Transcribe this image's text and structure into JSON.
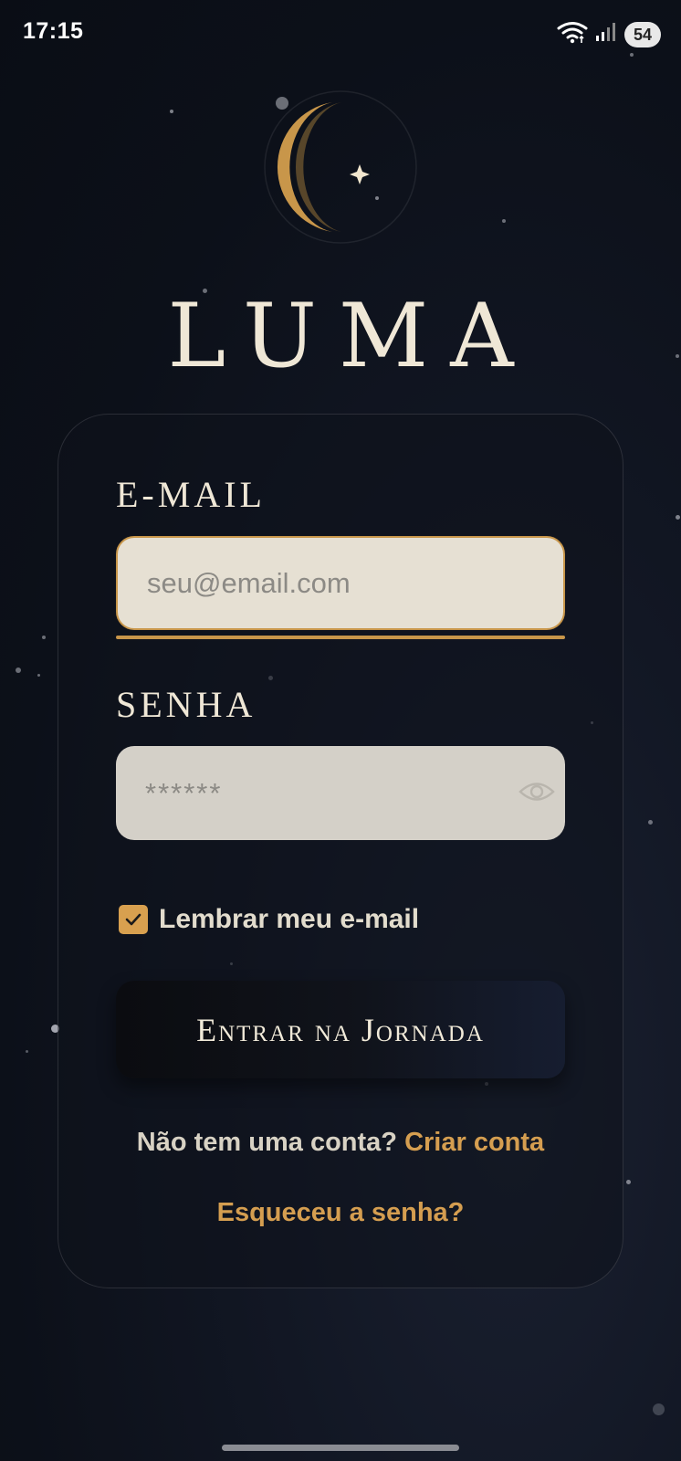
{
  "status_bar": {
    "time": "17:15",
    "battery": "54",
    "icons": [
      "wifi-icon",
      "signal-icon",
      "battery-icon"
    ]
  },
  "brand": {
    "name": "LUMA",
    "logo_icon": "crescent-moon-star-icon",
    "colors": {
      "gold": "#c8964a",
      "cream": "#efe7d6",
      "background": "#0e121c"
    }
  },
  "login_form": {
    "email_label": "E-MAIL",
    "email_placeholder": "seu@email.com",
    "password_label": "SENHA",
    "password_placeholder": "******",
    "show_password_icon": "eye-icon",
    "remember_label": "Lembrar meu e-mail",
    "remember_checked": true,
    "submit_label": "Entrar na Jornada",
    "no_account_text": "Não tem uma conta?",
    "create_account_link": "Criar conta",
    "forgot_password_link": "Esqueceu a senha?"
  }
}
